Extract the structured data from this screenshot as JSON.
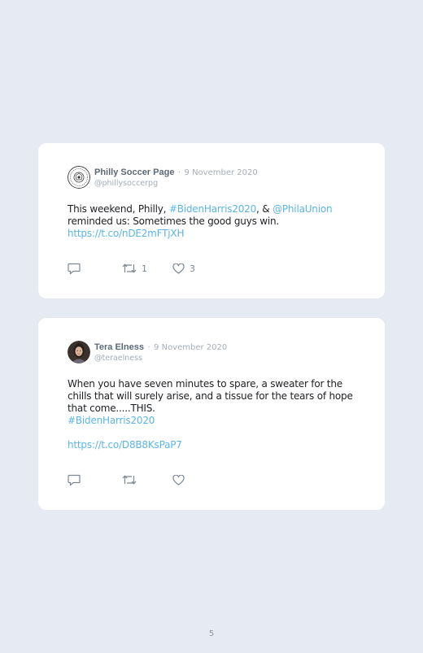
{
  "tweets": [
    {
      "name": "Philly Soccer Page",
      "separator": "·",
      "date": "9 November 2020",
      "handle": "@phillysoccerpg",
      "text": {
        "t1": "This weekend, Philly, ",
        "l1": "#BidenHarris2020",
        "t2": ", & ",
        "l2": "@PhilaUnion",
        "t3": " reminded us: Sometimes the good guys win.",
        "l3": "https://t.co/nDE2mFTjXH"
      },
      "retweets": "1",
      "likes": "3",
      "icons": {
        "reply": "reply-icon",
        "retweet": "retweet-icon",
        "like": "heart-icon"
      }
    },
    {
      "name": "Tera Elness",
      "separator": "·",
      "date": "9 November 2020",
      "handle": "@teraelness",
      "text": {
        "t1": "When you have seven minutes to spare, a sweater for the chills that will surely arise, and a tissue for the tears of hope that come.....THIS.",
        "l1": "#BidenHarris2020",
        "l2": "https://t.co/D8B8KsPaP7"
      },
      "icons": {
        "reply": "reply-icon",
        "retweet": "retweet-icon",
        "like": "heart-icon"
      }
    }
  ],
  "page_number": "5",
  "colors": {
    "background": "#e6ebf3",
    "card": "#ffffff",
    "link": "#5bb5e6",
    "muted": "#a4adb8",
    "icon": "#7c8794"
  }
}
